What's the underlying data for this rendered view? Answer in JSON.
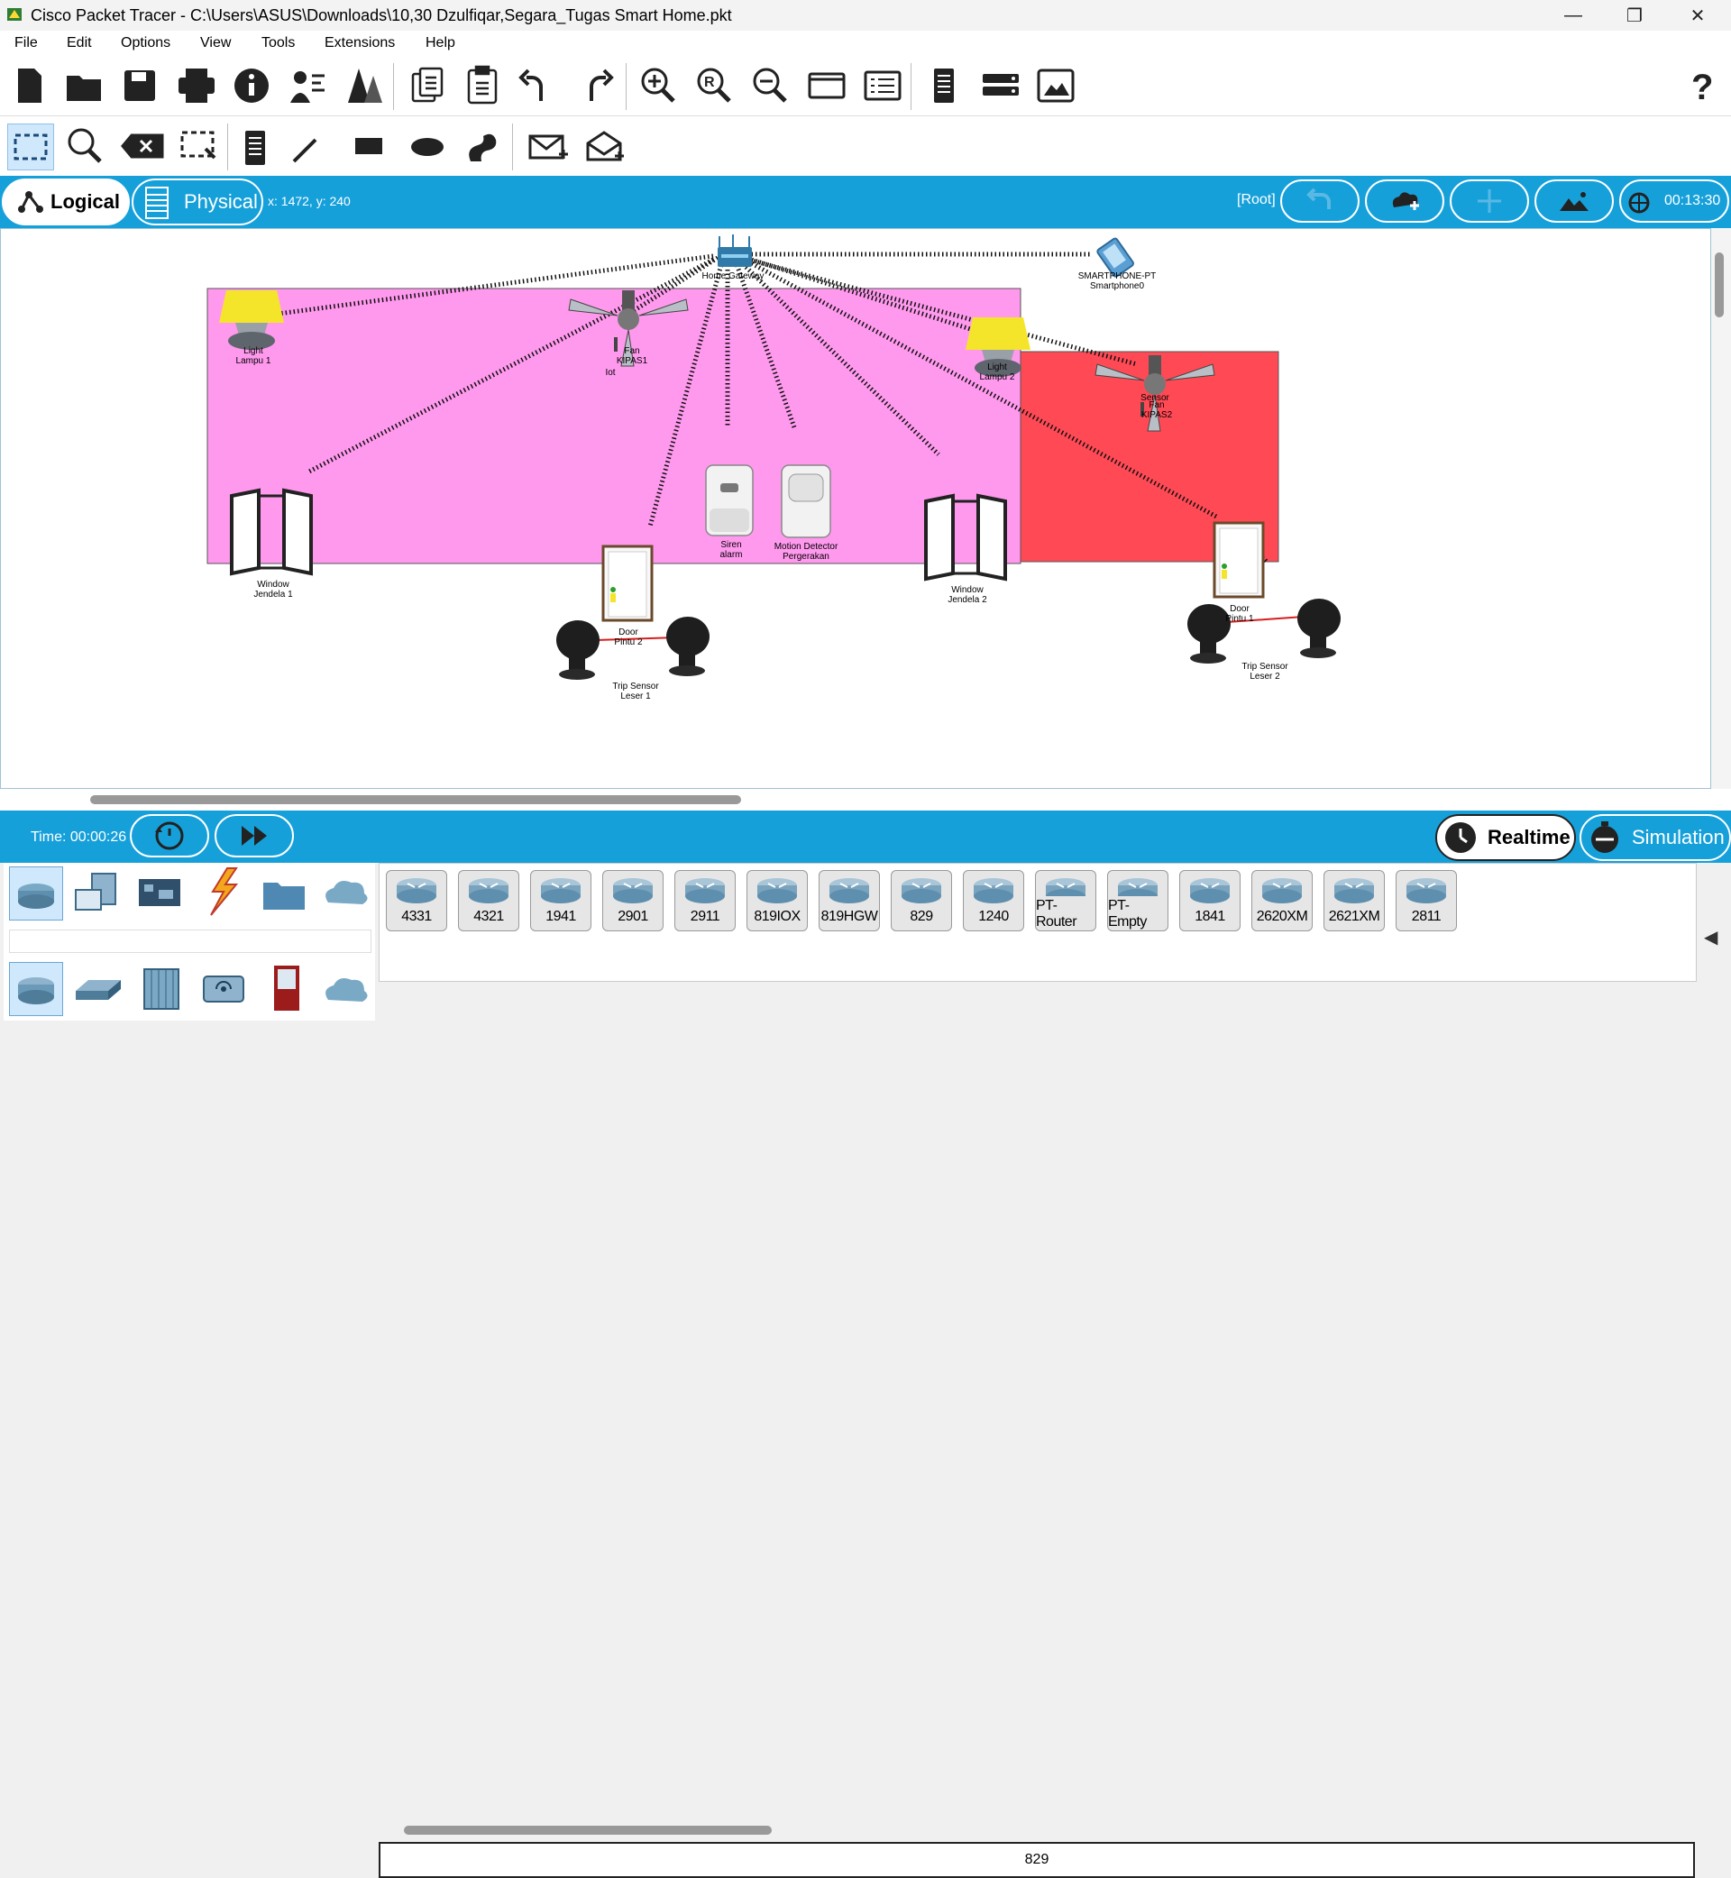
{
  "window": {
    "title": "Cisco Packet Tracer - C:\\Users\\ASUS\\Downloads\\10,30 Dzulfiqar,Segara_Tugas Smart Home.pkt"
  },
  "menu": [
    "File",
    "Edit",
    "Options",
    "View",
    "Tools",
    "Extensions",
    "Help"
  ],
  "toolbar1_icons": [
    "new-file-icon",
    "open-folder-icon",
    "save-icon",
    "print-icon",
    "info-icon",
    "activity-wizard-icon",
    "custom-pdu-icon",
    "copy-icon",
    "paste-icon",
    "undo-icon",
    "redo-icon",
    "zoom-in-icon",
    "zoom-reset-icon",
    "zoom-out-icon",
    "drawing-palette-icon",
    "custom-devices-icon",
    "note-icon",
    "device-list-icon",
    "image-icon",
    "help-icon"
  ],
  "toolbar2_icons": [
    "select-icon",
    "inspect-icon",
    "delete-icon",
    "resize-icon",
    "note-icon",
    "line-icon",
    "rectangle-icon",
    "ellipse-icon",
    "freeform-icon",
    "add-simple-pdu-icon",
    "add-complex-pdu-icon"
  ],
  "workspace": {
    "logical_label": "Logical",
    "physical_label": "Physical",
    "coords": "x: 1472, y: 240",
    "root_label": "[Root]",
    "clock": "00:13:30"
  },
  "areas": [
    {
      "name": "Iot",
      "color": "#ff99ee"
    },
    {
      "name": "Sensor",
      "color": "#ff4a55"
    }
  ],
  "devices": [
    {
      "type": "",
      "name": "Home Gateway"
    },
    {
      "type": "SMARTPHONE-PT",
      "name": "Smartphone0"
    },
    {
      "type": "Light",
      "name": "Lampu 1"
    },
    {
      "type": "Fan",
      "name": "KIPAS1"
    },
    {
      "type": "Light",
      "name": "Lampu 2"
    },
    {
      "type": "Fan",
      "name": "KIPAS2"
    },
    {
      "type": "Window",
      "name": "Jendela 1"
    },
    {
      "type": "Window",
      "name": "Jendela 2"
    },
    {
      "type": "Siren",
      "name": "alarm"
    },
    {
      "type": "Motion Detector",
      "name": "Pergerakan"
    },
    {
      "type": "Door",
      "name": "Pintu 2"
    },
    {
      "type": "Door",
      "name": "Pintu 1"
    },
    {
      "type": "Trip Sensor",
      "name": "Leser 1"
    },
    {
      "type": "Trip Sensor",
      "name": "Leser 2"
    }
  ],
  "time": {
    "label": "Time: 00:00:26"
  },
  "modes": {
    "realtime": "Realtime",
    "simulation": "Simulation"
  },
  "routers": [
    "4331",
    "4321",
    "1941",
    "2901",
    "2911",
    "819IOX",
    "819HGW",
    "829",
    "1240",
    "PT-Router",
    "PT-Empty",
    "1841",
    "2620XM",
    "2621XM",
    "2811"
  ],
  "selected_device": "829"
}
